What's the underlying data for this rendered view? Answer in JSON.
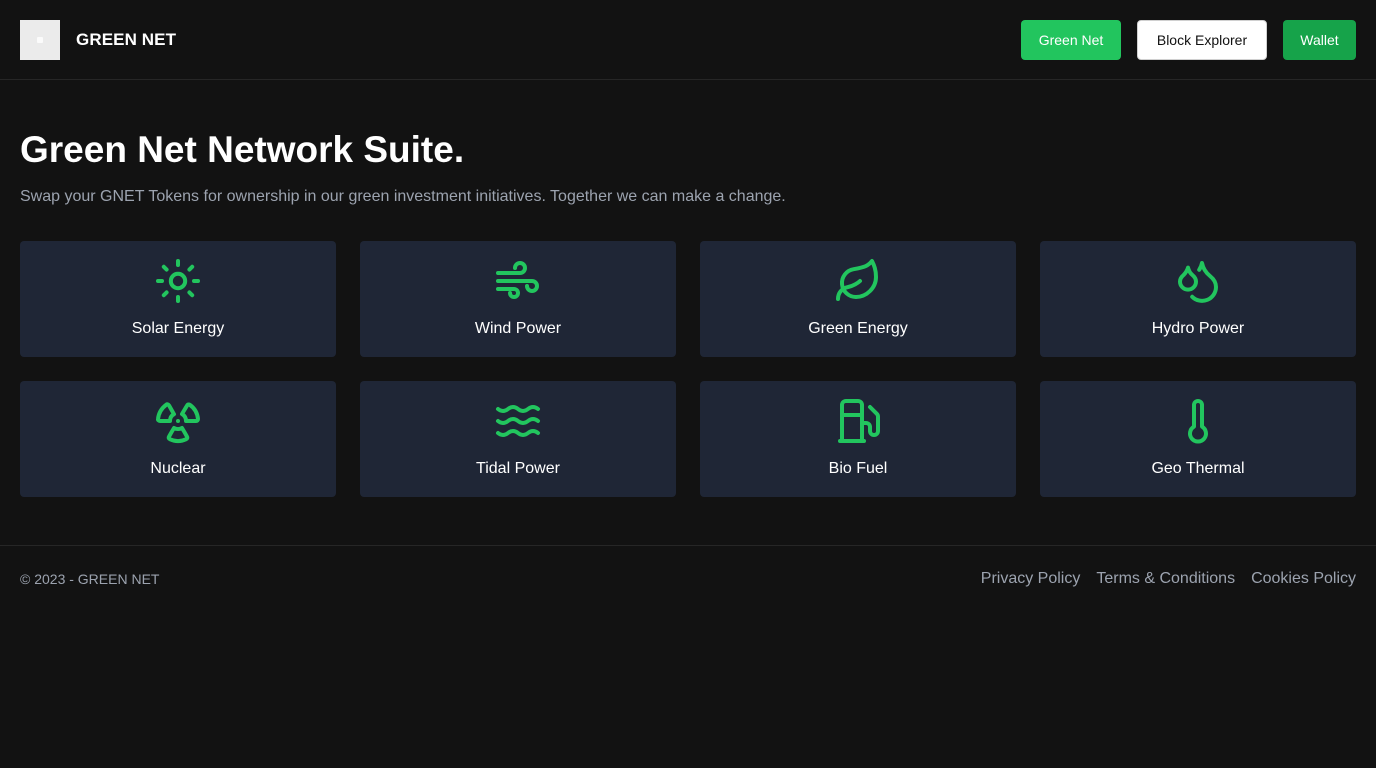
{
  "header": {
    "brand": "GREEN NET",
    "logo_icon": "logo-placeholder",
    "buttons": [
      {
        "label": "Green Net",
        "color": "#22c55e"
      },
      {
        "label": "Block Explorer",
        "color": "#ffffff"
      },
      {
        "label": "Wallet",
        "color": "#16a34a"
      }
    ]
  },
  "hero": {
    "title": "Green Net Network Suite.",
    "subtitle": "Swap your GNET Tokens for ownership in our green investment initiatives. Together we can make a change."
  },
  "cards": [
    {
      "label": "Solar Energy",
      "icon": "sun-icon"
    },
    {
      "label": "Wind Power",
      "icon": "wind-icon"
    },
    {
      "label": "Green Energy",
      "icon": "leaf-icon"
    },
    {
      "label": "Hydro Power",
      "icon": "droplets-icon"
    },
    {
      "label": "Nuclear",
      "icon": "radiation-icon"
    },
    {
      "label": "Tidal Power",
      "icon": "waves-icon"
    },
    {
      "label": "Bio Fuel",
      "icon": "fuel-pump-icon"
    },
    {
      "label": "Geo Thermal",
      "icon": "thermometer-icon"
    }
  ],
  "footer": {
    "copyright": "© 2023 - GREEN NET",
    "links": [
      {
        "label": "Privacy Policy"
      },
      {
        "label": "Terms & Conditions"
      },
      {
        "label": "Cookies Policy"
      }
    ]
  },
  "colors": {
    "accent": "#22c55e",
    "background": "#121212",
    "card": "#1f2636",
    "muted_text": "#9ca3af"
  }
}
